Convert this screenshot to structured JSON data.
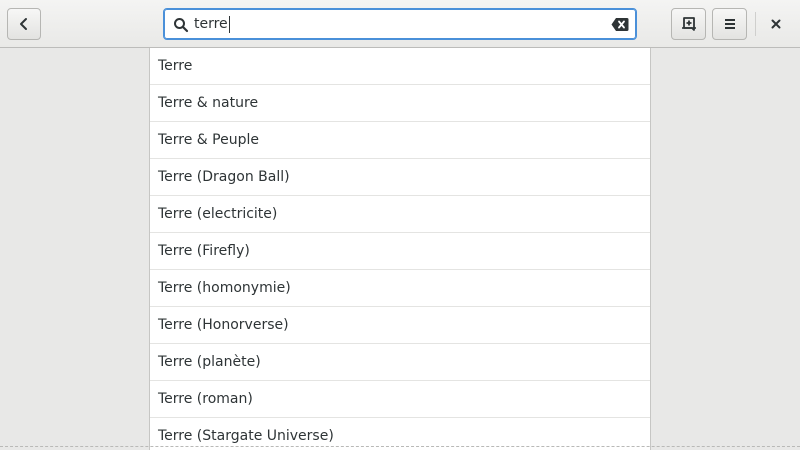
{
  "search": {
    "value": "terre"
  },
  "results": [
    "Terre",
    "Terre & nature",
    "Terre & Peuple",
    "Terre (Dragon Ball)",
    "Terre (electricite)",
    "Terre (Firefly)",
    "Terre (homonymie)",
    "Terre (Honorverse)",
    "Terre (planète)",
    "Terre (roman)",
    "Terre (Stargate Universe)"
  ],
  "icons": {
    "back": "chevron-left-icon",
    "search": "search-icon",
    "clear": "clear-icon",
    "bookmark": "bookmark-add-icon",
    "menu": "menu-icon",
    "close": "close-icon"
  },
  "colors": {
    "focus": "#4a90d9",
    "background": "#e8e8e7"
  }
}
